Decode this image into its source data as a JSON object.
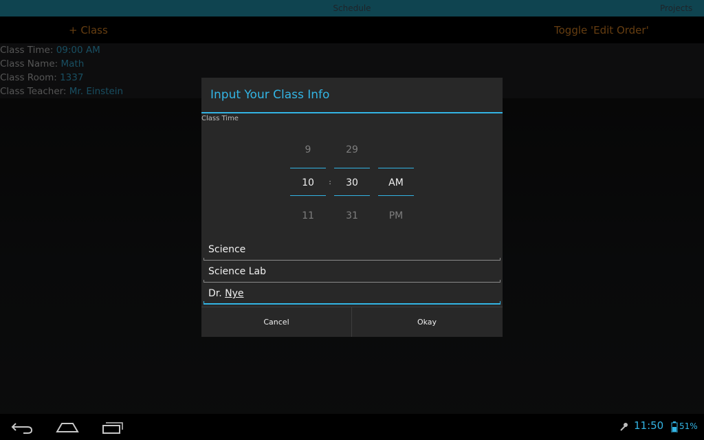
{
  "tabs": [
    {
      "label": "Schedule"
    },
    {
      "label": "Projects"
    }
  ],
  "action_bar": {
    "add_class_label": "+ Class",
    "toggle_edit_label": "Toggle 'Edit Order'"
  },
  "class_item": {
    "time_label": "Class Time: ",
    "time_value": "09:00 AM",
    "name_label": "Class Name: ",
    "name_value": "Math",
    "room_label": "Class Room: ",
    "room_value": "1337",
    "teacher_label": "Class Teacher: ",
    "teacher_value": "Mr.  Einstein"
  },
  "dialog": {
    "title": "Input Your Class Info",
    "section_label": "Class Time",
    "picker": {
      "hour": {
        "prev": "9",
        "current": "10",
        "next": "11"
      },
      "separator": ":",
      "minute": {
        "prev": "29",
        "current": "30",
        "next": "31"
      },
      "ampm": {
        "prev": "",
        "current": "AM",
        "next": "PM"
      }
    },
    "fields": {
      "name_value": "Science",
      "room_value": "Science Lab",
      "teacher_prefix": "Dr. ",
      "teacher_suffix": "Nye"
    },
    "cancel_label": "Cancel",
    "okay_label": "Okay"
  },
  "system_bar": {
    "time": "11:50",
    "battery_percent": "51%"
  },
  "colors": {
    "accent": "#33b5e5",
    "action_text": "#b8701f",
    "tab_bar": "#1d7c93"
  },
  "icons": [
    "back-icon",
    "home-icon",
    "recents-icon",
    "notification-icon",
    "battery-icon"
  ]
}
